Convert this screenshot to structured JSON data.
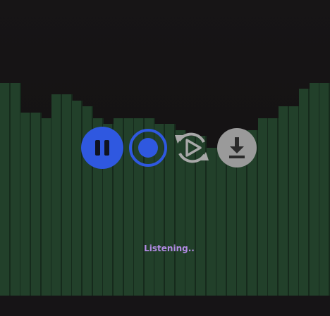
{
  "status": {
    "text": "Listening.."
  },
  "controls": {
    "pause_icon": "pause-icon",
    "record_icon": "record-icon",
    "replay_icon": "replay-icon",
    "download_icon": "download-icon"
  },
  "visualizer": {
    "levels": [
      0.72,
      0.72,
      0.62,
      0.62,
      0.6,
      0.68,
      0.68,
      0.66,
      0.64,
      0.6,
      0.58,
      0.6,
      0.6,
      0.6,
      0.6,
      0.58,
      0.58,
      0.56,
      0.54,
      0.54,
      0.5,
      0.5,
      0.54,
      0.56,
      0.56,
      0.6,
      0.6,
      0.64,
      0.64,
      0.7,
      0.72,
      0.72
    ]
  },
  "colors": {
    "bar": "#22402a",
    "accent": "#2f58e0",
    "status_text": "#b28be4",
    "muted_button": "#9a9a9a"
  }
}
